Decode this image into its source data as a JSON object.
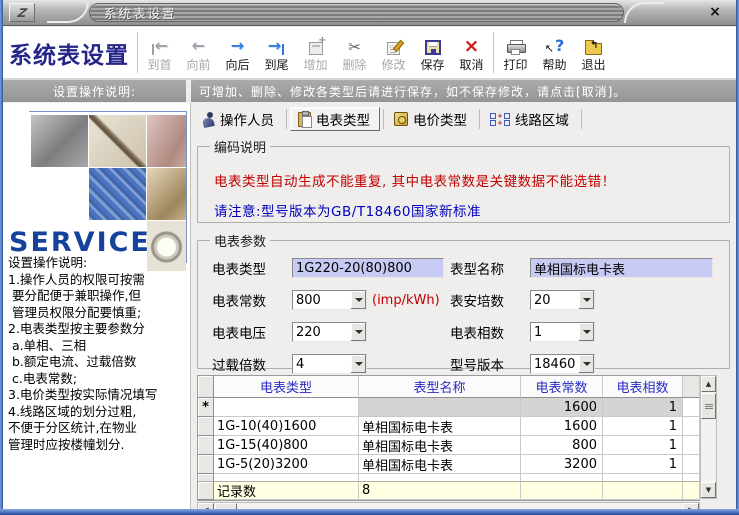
{
  "window": {
    "title": "系统表设置",
    "close_glyph": "×"
  },
  "app_title": "系统表设置",
  "colors": {
    "accent_navy": "#26268a",
    "frame_blue": "#2c55a5",
    "input_lavender": "#c7caf3",
    "warning_red": "#c00000",
    "note_blue": "#0000bd",
    "header_bar_gray": "#9d9d9d",
    "table_header_blue": "#2a2ac4",
    "footer_yellow": "#ffffe1",
    "service_blue": "#15429b"
  },
  "toolbar": {
    "buttons": [
      {
        "label": "到首",
        "icon": "goto-first-icon",
        "enabled": false
      },
      {
        "label": "向前",
        "icon": "previous-icon",
        "enabled": false
      },
      {
        "label": "向后",
        "icon": "next-icon",
        "enabled": true
      },
      {
        "label": "到尾",
        "icon": "goto-last-icon",
        "enabled": true
      },
      {
        "label": "增加",
        "icon": "add-record-icon",
        "enabled": false
      },
      {
        "label": "删除",
        "icon": "delete-record-icon",
        "enabled": false
      },
      {
        "label": "修改",
        "icon": "modify-record-icon",
        "enabled": false
      },
      {
        "label": "保存",
        "icon": "save-icon",
        "enabled": true
      },
      {
        "label": "取消",
        "icon": "cancel-icon",
        "enabled": true
      },
      {
        "label": "打印",
        "icon": "print-icon",
        "enabled": true
      },
      {
        "label": "帮助",
        "icon": "help-icon",
        "enabled": true
      },
      {
        "label": "退出",
        "icon": "exit-icon",
        "enabled": true
      }
    ]
  },
  "sidebar": {
    "header": "设置操作说明:",
    "service_text": "SERVICE",
    "instructions": "设置操作说明:\n1.操作人员的权限可按需\n 要分配便于兼职操作,但\n 管理员权限分配要慎重;\n2.电表类型按主要参数分\n a.单相、三相\n b.额定电流、过载倍数\n c.电表常数;\n3.电价类型按实际情况填写\n4.线路区域的划分过粗,\n不便于分区统计,在物业\n管理时应按楼幢划分."
  },
  "statusbar": {
    "message": "可增加、删除、修改各类型后请进行保存，如不保存修改，请点击[取消]。"
  },
  "tabs": [
    {
      "label": "操作人员",
      "icon": "operator-icon",
      "selected": false
    },
    {
      "label": "电表类型",
      "icon": "meter-type-icon",
      "selected": true
    },
    {
      "label": "电价类型",
      "icon": "price-type-icon",
      "selected": false
    },
    {
      "label": "线路区域",
      "icon": "line-area-icon",
      "selected": false
    }
  ],
  "coding_notes": {
    "legend": "编码说明",
    "warning": "电表类型自动生成不能重复, 其中电表常数是关键数据不能选错！",
    "note": "请注意:型号版本为GB/T18460国家新标准"
  },
  "meter_params": {
    "legend": "电表参数",
    "meter_type": {
      "label": "电表类型",
      "value": "1G220-20(80)800"
    },
    "model_name": {
      "label": "表型名称",
      "value": "单相国标电卡表"
    },
    "meter_constant": {
      "label": "电表常数",
      "value": "800",
      "suffix": "(imp/kWh)"
    },
    "amperage": {
      "label": "表安培数",
      "value": "20"
    },
    "voltage": {
      "label": "电表电压",
      "value": "220"
    },
    "phases": {
      "label": "电表相数",
      "value": "1"
    },
    "overload": {
      "label": "过载倍数",
      "value": "4"
    },
    "model_version": {
      "label": "型号版本",
      "value": "18460"
    }
  },
  "table": {
    "headers": [
      "电表类型",
      "表型名称",
      "电表常数",
      "电表相数"
    ],
    "rows": [
      {
        "marker": "*",
        "type": "",
        "name": "",
        "constant": "1600",
        "phases": "1"
      },
      {
        "marker": "",
        "type": "1G-10(40)1600",
        "name": "单相国标电卡表",
        "constant": "1600",
        "phases": "1"
      },
      {
        "marker": "",
        "type": "1G-15(40)800",
        "name": "单相国标电卡表",
        "constant": "800",
        "phases": "1"
      },
      {
        "marker": "",
        "type": "1G-5(20)3200",
        "name": "单相国标电卡表",
        "constant": "3200",
        "phases": "1"
      }
    ],
    "footer": {
      "label": "记录数",
      "value": "8"
    }
  }
}
